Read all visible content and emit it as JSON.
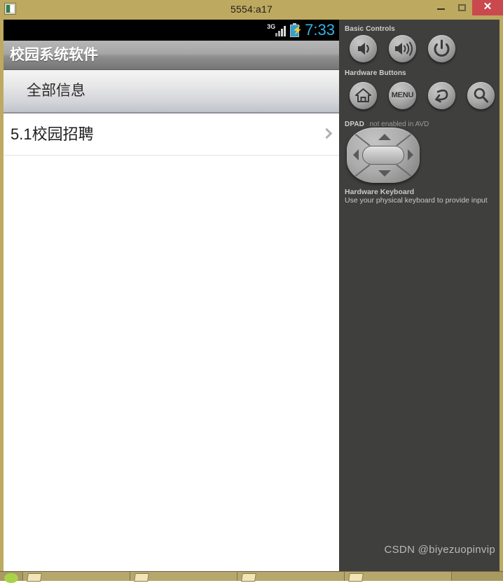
{
  "window": {
    "title": "5554:a17",
    "icon": "emulator-app-icon",
    "controls": {
      "minimize": "–",
      "maximize": "□",
      "close": "✕"
    }
  },
  "device": {
    "status_bar": {
      "network_type": "3G",
      "signal_icon": "signal-bars-icon",
      "battery_icon": "battery-charging-icon",
      "battery_bolt": "⚡",
      "clock": "7:33",
      "clock_color": "#34b4e8"
    },
    "action_bar": {
      "app_title": "校园系统软件"
    },
    "section_header": {
      "label": "全部信息"
    },
    "list": {
      "items": [
        {
          "label": "5.1校园招聘",
          "chevron": "chevron-right-icon"
        }
      ]
    },
    "watermark": "CSDN @biyezuopinvip"
  },
  "control_panel": {
    "basic_controls": {
      "label": "Basic Controls",
      "buttons": [
        {
          "name": "volume-down-button",
          "icon": "volume-down-icon"
        },
        {
          "name": "volume-up-button",
          "icon": "volume-up-icon"
        },
        {
          "name": "power-button",
          "icon": "power-icon"
        }
      ]
    },
    "hardware_buttons": {
      "label": "Hardware Buttons",
      "buttons": [
        {
          "name": "home-button",
          "icon": "home-icon",
          "label": ""
        },
        {
          "name": "menu-button",
          "icon": "menu-text-icon",
          "label": "MENU"
        },
        {
          "name": "back-button",
          "icon": "back-arrow-icon",
          "label": ""
        },
        {
          "name": "search-button",
          "icon": "search-icon",
          "label": ""
        }
      ]
    },
    "dpad": {
      "label": "DPAD",
      "status": "not enabled in AVD",
      "icon": "dpad-icon"
    },
    "hardware_keyboard": {
      "label": "Hardware Keyboard",
      "hint": "Use your physical keyboard to provide input"
    }
  },
  "taskbar": {
    "items": [
      {
        "name": "start-button",
        "icon": "start-orb-icon"
      },
      {
        "name": "taskbar-item-1",
        "icon": "folder-icon"
      },
      {
        "name": "taskbar-item-2",
        "icon": "folder-icon"
      },
      {
        "name": "taskbar-item-3",
        "icon": "folder-icon"
      },
      {
        "name": "taskbar-item-4",
        "icon": "folder-icon"
      }
    ]
  },
  "colors": {
    "window_chrome": "#bda960",
    "panel_bg": "#3f3f3e",
    "close_button": "#c9494f",
    "accent_clock": "#34b4e8"
  }
}
